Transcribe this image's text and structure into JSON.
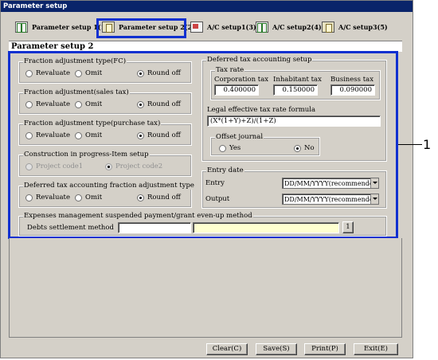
{
  "window": {
    "title": "Parameter setup"
  },
  "tabs": [
    {
      "label": "Parameter setup 1(1)",
      "icon": "book-icon"
    },
    {
      "label": "Parameter setup 2(2)",
      "icon": "ledger-icon",
      "selected": true
    },
    {
      "label": "A/C setup1(3)",
      "icon": "account-icon"
    },
    {
      "label": "A/C setup2(4)",
      "icon": "book-icon"
    },
    {
      "label": "A/C setup3(5)",
      "icon": "ledger-icon"
    }
  ],
  "panel": {
    "title": "Parameter setup 2"
  },
  "groups": {
    "fc": {
      "caption": "Fraction adjustment type(FC)",
      "options": [
        "Revaluate",
        "Omit",
        "Round off"
      ],
      "selected": 2
    },
    "sales": {
      "caption": "Fraction adjustment(sales tax)",
      "options": [
        "Revaluate",
        "Omit",
        "Round off"
      ],
      "selected": 2
    },
    "purchase": {
      "caption": "Fraction adjustment type(purchase tax)",
      "options": [
        "Revaluate",
        "Omit",
        "Round off"
      ],
      "selected": 2
    },
    "construction": {
      "caption": "Construction in progress-Item setup",
      "options": [
        "Project code1",
        "Project code2"
      ],
      "selected": 1
    },
    "deferred_fraction": {
      "caption": "Deferred tax accounting fraction adjustment type",
      "options": [
        "Revaluate",
        "Omit",
        "Round off"
      ],
      "selected": 2
    }
  },
  "deferred_tax": {
    "caption": "Deferred tax accounting setup",
    "tax_rate": {
      "caption": "Tax rate",
      "corporation_label": "Corporation tax",
      "corporation_value": "0.400000",
      "inhabitant_label": "Inhabitant tax",
      "inhabitant_value": "0.150000",
      "business_label": "Business tax",
      "business_value": "0.090000"
    },
    "formula_label": "Legal effective tax rate formula",
    "formula_value": "(X*(1+Y)+Z)/(1+Z)",
    "offset": {
      "caption": "Offset journal",
      "options": [
        "Yes",
        "No"
      ],
      "selected": 1
    }
  },
  "entry_date": {
    "caption": "Entry date",
    "entry_label": "Entry",
    "entry_value": "DD/MM/YYYY(recommended)",
    "output_label": "Output",
    "output_value": "DD/MM/YYYY(recommended)"
  },
  "expenses": {
    "caption": "Expenses management suspended payment/grant even-up method",
    "debts_label": "Debts settlement method",
    "code_value": "",
    "name_value": "",
    "lookup_label": "1"
  },
  "buttons": {
    "clear": "Clear(C)",
    "save": "Save(S)",
    "print": "Print(P)",
    "exit": "Exit(E)"
  },
  "callout": {
    "number": "1"
  },
  "colors": {
    "highlight": "#1030d0",
    "titlebar": "#0a246a",
    "face": "#d4d0c8"
  }
}
